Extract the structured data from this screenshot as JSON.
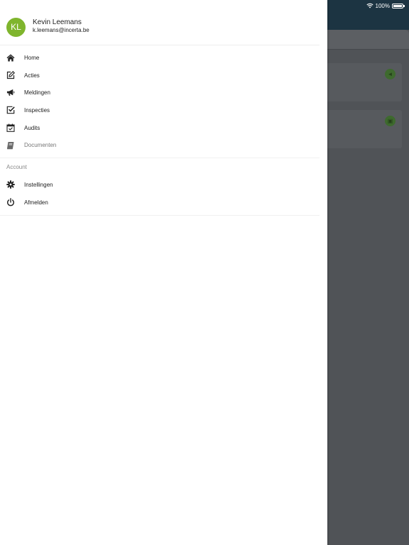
{
  "status_bar": {
    "battery_text": "100%",
    "icons": [
      "wifi-icon",
      "battery-icon"
    ]
  },
  "profile": {
    "initials": "KL",
    "name": "Kevin Leemans",
    "email": "k.leemans@incerta.be",
    "avatar_color": "#7fb52d"
  },
  "menu": {
    "items": [
      {
        "label": "Home",
        "icon": "home-icon",
        "enabled": true
      },
      {
        "label": "Acties",
        "icon": "edit-icon",
        "enabled": true
      },
      {
        "label": "Meldingen",
        "icon": "megaphone-icon",
        "enabled": true
      },
      {
        "label": "Inspecties",
        "icon": "checkbox-icon",
        "enabled": true
      },
      {
        "label": "Audits",
        "icon": "calendar-check-icon",
        "enabled": true
      },
      {
        "label": "Documenten",
        "icon": "book-icon",
        "enabled": false
      }
    ]
  },
  "account": {
    "header": "Account",
    "items": [
      {
        "label": "Instellingen",
        "icon": "gear-icon"
      },
      {
        "label": "Afmelden",
        "icon": "power-icon"
      }
    ]
  },
  "colors": {
    "overlay": "#505357",
    "header_bg": "#1c3442",
    "accent_green": "#7fb52d"
  }
}
